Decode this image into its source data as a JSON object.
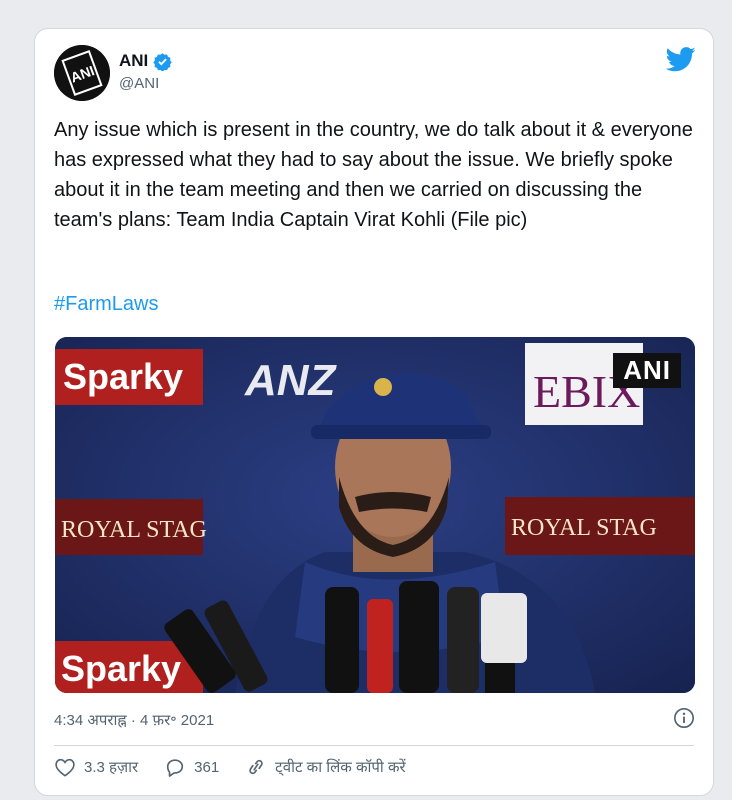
{
  "tweet": {
    "display_name": "ANI",
    "handle": "@ANI",
    "verified": true,
    "avatar_text": "ANI",
    "text": "Any issue which is present in the country, we do talk about it & everyone has expressed what they had to say about the issue. We briefly spoke about it in the team meeting and then we carried on discussing the team's plans: Team India Captain Virat Kohli (File pic)",
    "hashtag": "#FarmLaws",
    "timestamp": "4:34 अपराह्न · 4 फ़र॰ 2021"
  },
  "media": {
    "watermark": "ANI",
    "sponsor_banners": [
      "Sparky",
      "ROYAL STAG",
      "ROYAL STAG",
      "Sparky",
      "EBIX"
    ]
  },
  "actions": {
    "likes": "3.3 हज़ार",
    "replies": "361",
    "copy_link": "ट्वीट का लिंक कॉपी करें"
  },
  "colors": {
    "brand_blue": "#1d9bf0",
    "text": "#0f1419",
    "muted": "#536471",
    "backdrop": "#1f2f6b",
    "banner_red": "#b0201e"
  },
  "icons": [
    "twitter-bird-icon",
    "verified-badge-icon",
    "info-icon",
    "heart-icon",
    "reply-icon",
    "link-icon"
  ]
}
